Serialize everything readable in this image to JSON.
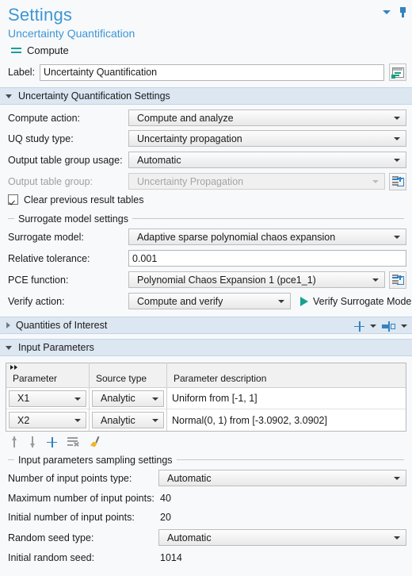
{
  "window": {
    "title": "Settings",
    "subtitle": "Uncertainty Quantification",
    "node_label": "Compute",
    "node_icon": "equals-icon",
    "collapse_icon": "caret-down-icon",
    "pin_icon": "pin-icon",
    "accent_color": "#3d96d4",
    "header_band_color": "#dce7f2"
  },
  "label_row": {
    "label": "Label:",
    "value": "Uncertainty Quantification",
    "placeholder": "",
    "button_icon": "form-window-icon"
  },
  "uq_settings": {
    "header": "Uncertainty Quantification Settings",
    "expanded": true,
    "rows": [
      {
        "label": "Compute action:",
        "value": "Compute and analyze",
        "kind": "combo",
        "disabled": false
      },
      {
        "label": "UQ study type:",
        "value": "Uncertainty propagation",
        "kind": "combo",
        "disabled": false
      },
      {
        "label": "Output table group usage:",
        "value": "Automatic",
        "kind": "combo",
        "disabled": false
      },
      {
        "label": "Output table group:",
        "value": "Uncertainty Propagation",
        "kind": "combo",
        "disabled": true,
        "side_button_icon": "new-table-icon"
      }
    ],
    "checkbox": {
      "label": "Clear previous result tables",
      "checked": true
    }
  },
  "surrogate_group": {
    "title": "Surrogate model settings",
    "rows": [
      {
        "label": "Surrogate model:",
        "value": "Adaptive sparse polynomial chaos expansion",
        "kind": "combo"
      },
      {
        "label": "Relative tolerance:",
        "value": "0.001",
        "kind": "text"
      },
      {
        "label": "PCE function:",
        "value": "Polynomial Chaos Expansion 1 (pce1_1)",
        "kind": "combo",
        "side_button_icon": "new-table-icon"
      },
      {
        "label": "Verify action:",
        "value": "Compute and verify",
        "kind": "combo-short"
      }
    ],
    "verify_button": {
      "label": "Verify Surrogate Model",
      "icon": "play-icon",
      "icon_color": "#19a08f"
    }
  },
  "quantities_of_interest": {
    "header": "Quantities of Interest",
    "expanded": false,
    "tools": [
      {
        "icon": "plus-icon",
        "name": "add"
      },
      {
        "icon": "caret-down-icon",
        "name": "add-menu"
      },
      {
        "icon": "toggle-columns-icon",
        "name": "columns"
      },
      {
        "icon": "caret-down-icon",
        "name": "columns-menu"
      }
    ]
  },
  "input_parameters": {
    "header": "Input Parameters",
    "expanded": true,
    "table": {
      "corner_icon": "double-chevron-right-icon",
      "columns": [
        "Parameter",
        "Source type",
        "Parameter description"
      ],
      "rows": [
        {
          "parameter": "X1",
          "source_type": "Analytic",
          "description": "Uniform from [-1, 1]"
        },
        {
          "parameter": "X2",
          "source_type": "Analytic",
          "description": "Normal(0, 1) from [-3.0902, 3.0902]"
        }
      ]
    },
    "toolbar": [
      {
        "icon": "arrow-up-icon",
        "name": "move-up"
      },
      {
        "icon": "arrow-down-icon",
        "name": "move-down"
      },
      {
        "icon": "plus-icon",
        "name": "add-parameter"
      },
      {
        "icon": "clear-list-icon",
        "name": "delete-parameter"
      },
      {
        "icon": "broom-icon",
        "name": "clear-table"
      }
    ]
  },
  "sampling_group": {
    "title": "Input parameters sampling settings",
    "rows": [
      {
        "label": "Number of input points type:",
        "value": "Automatic",
        "kind": "combo"
      },
      {
        "label": "Maximum number of input points:",
        "value": "40",
        "kind": "plain"
      },
      {
        "label": "Initial number of input points:",
        "value": "20",
        "kind": "plain"
      },
      {
        "label": "Random seed type:",
        "value": "Automatic",
        "kind": "combo"
      },
      {
        "label": "Initial random seed:",
        "value": "1014",
        "kind": "plain"
      }
    ]
  }
}
